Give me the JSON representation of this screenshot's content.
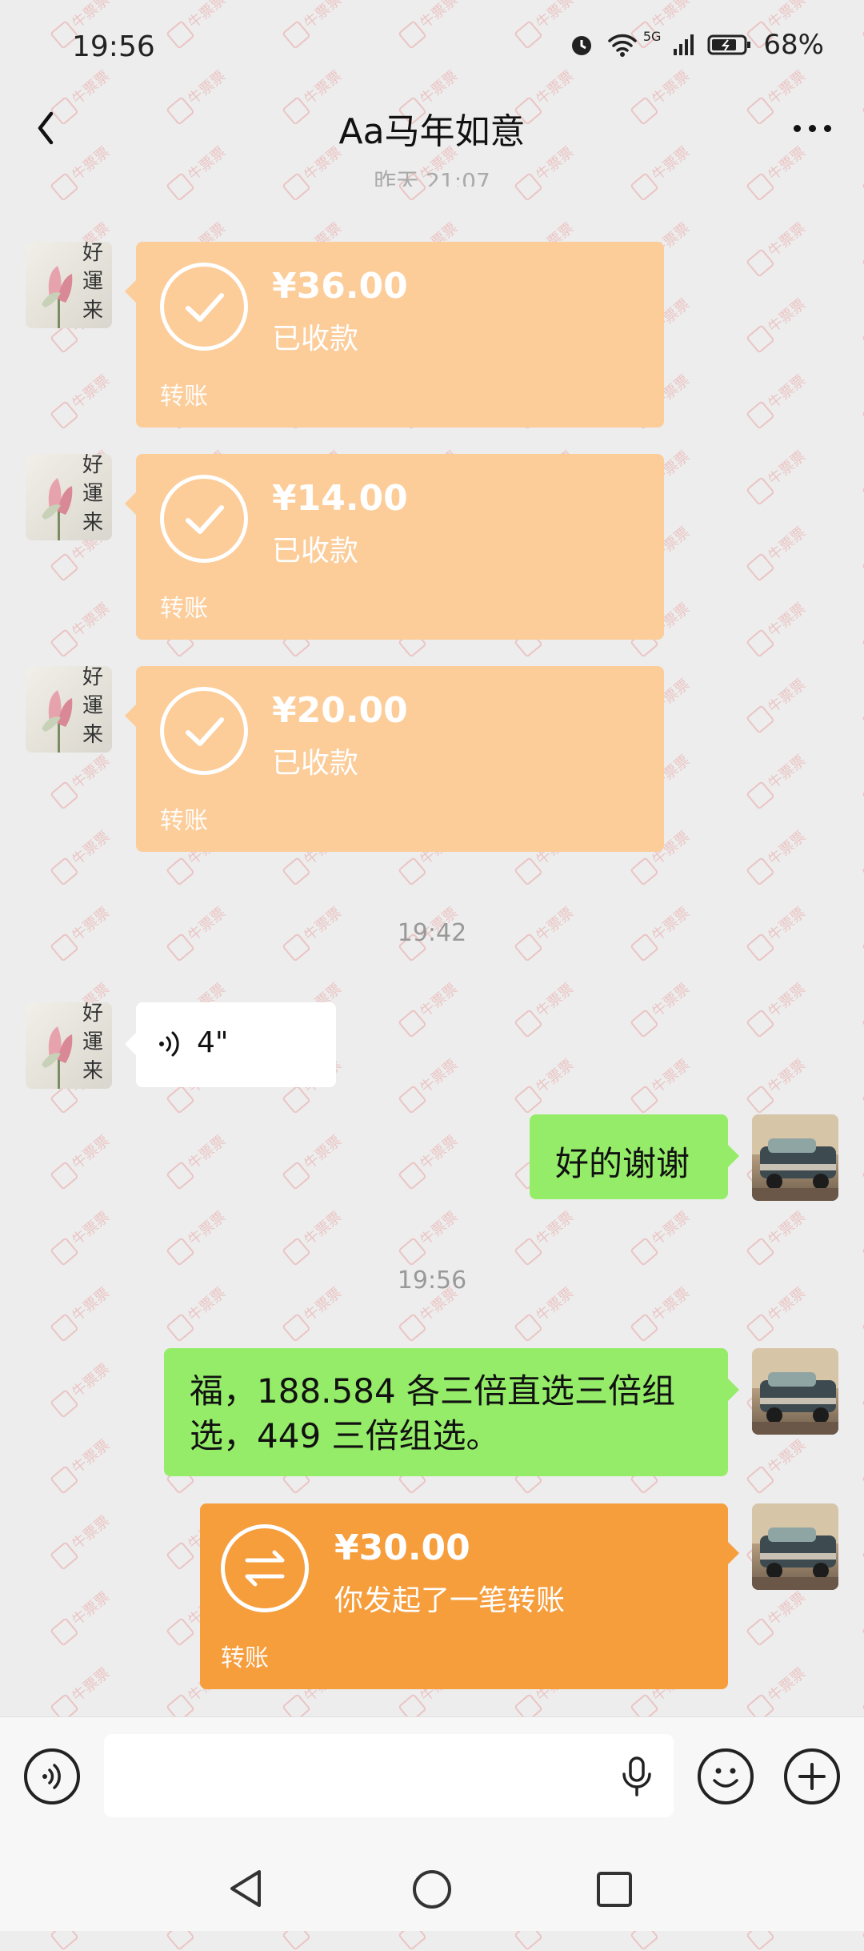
{
  "status_bar": {
    "time": "19:56",
    "network": "5G",
    "battery": "68%"
  },
  "header": {
    "title": "Aa马年如意",
    "partial_time": "昨天 21:07"
  },
  "messages": {
    "transfers_received": [
      {
        "amount": "¥36.00",
        "status": "已收款",
        "label": "转账"
      },
      {
        "amount": "¥14.00",
        "status": "已收款",
        "label": "转账"
      },
      {
        "amount": "¥20.00",
        "status": "已收款",
        "label": "转账"
      }
    ],
    "time_1": "19:42",
    "voice_duration": "4\"",
    "reply_1": "好的谢谢",
    "time_2": "19:56",
    "reply_2": "福，188.584 各三倍直选三倍组选，449 三倍组选。",
    "transfer_sent": {
      "amount": "¥30.00",
      "status": "你发起了一笔转账",
      "label": "转账"
    }
  },
  "avatars": {
    "contact": "好運来",
    "self": "car-photo"
  },
  "watermark": "牛票票",
  "colors": {
    "received_card": "#fccc99",
    "sent_card": "#f69d3c",
    "green_bubble": "#95ec69",
    "background": "#ededed"
  }
}
